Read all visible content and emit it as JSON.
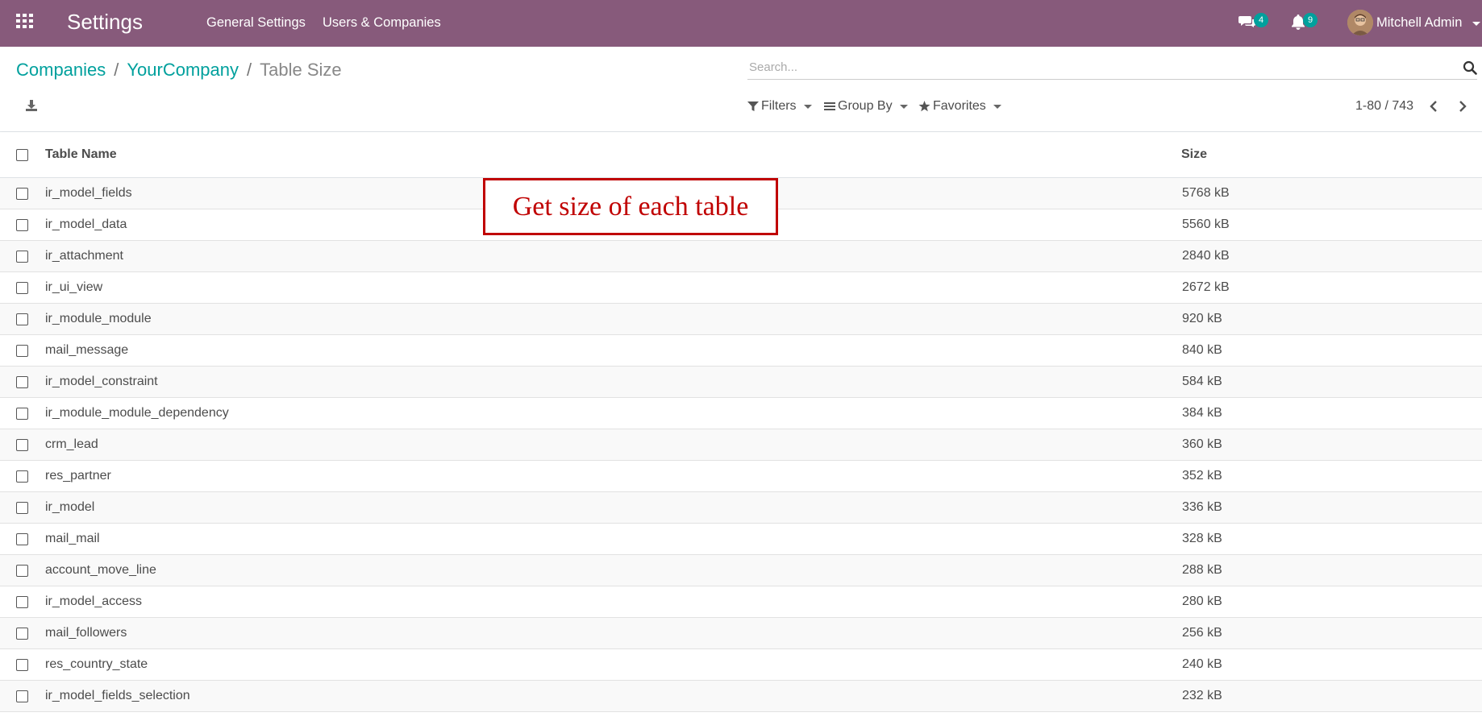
{
  "navbar": {
    "app_title": "Settings",
    "menu": [
      "General Settings",
      "Users & Companies"
    ],
    "messages_count": "4",
    "activity_count": "9",
    "user_name": "Mitchell Admin",
    "brand_color": "#875a7b",
    "badge_color": "#00a09d",
    "icons": [
      "apps-grid-icon",
      "chat-icon",
      "bell-icon"
    ]
  },
  "breadcrumb": {
    "items": [
      "Companies",
      "YourCompany"
    ],
    "current": "Table Size"
  },
  "search": {
    "placeholder": "Search...",
    "value": ""
  },
  "controls": {
    "filters": "Filters",
    "group_by": "Group By",
    "favorites": "Favorites",
    "pager": "1-80 / 743"
  },
  "list": {
    "columns": [
      "Table Name",
      "Size"
    ],
    "rows": [
      {
        "name": "ir_model_fields",
        "size": "5768 kB"
      },
      {
        "name": "ir_model_data",
        "size": "5560 kB"
      },
      {
        "name": "ir_attachment",
        "size": "2840 kB"
      },
      {
        "name": "ir_ui_view",
        "size": "2672 kB"
      },
      {
        "name": "ir_module_module",
        "size": "920 kB"
      },
      {
        "name": "mail_message",
        "size": "840 kB"
      },
      {
        "name": "ir_model_constraint",
        "size": "584 kB"
      },
      {
        "name": "ir_module_module_dependency",
        "size": "384 kB"
      },
      {
        "name": "crm_lead",
        "size": "360 kB"
      },
      {
        "name": "res_partner",
        "size": "352 kB"
      },
      {
        "name": "ir_model",
        "size": "336 kB"
      },
      {
        "name": "mail_mail",
        "size": "328 kB"
      },
      {
        "name": "account_move_line",
        "size": "288 kB"
      },
      {
        "name": "ir_model_access",
        "size": "280 kB"
      },
      {
        "name": "mail_followers",
        "size": "256 kB"
      },
      {
        "name": "res_country_state",
        "size": "240 kB"
      },
      {
        "name": "ir_model_fields_selection",
        "size": "232 kB"
      }
    ]
  },
  "annotation": {
    "text": "Get size of each table",
    "color": "#c00000"
  }
}
